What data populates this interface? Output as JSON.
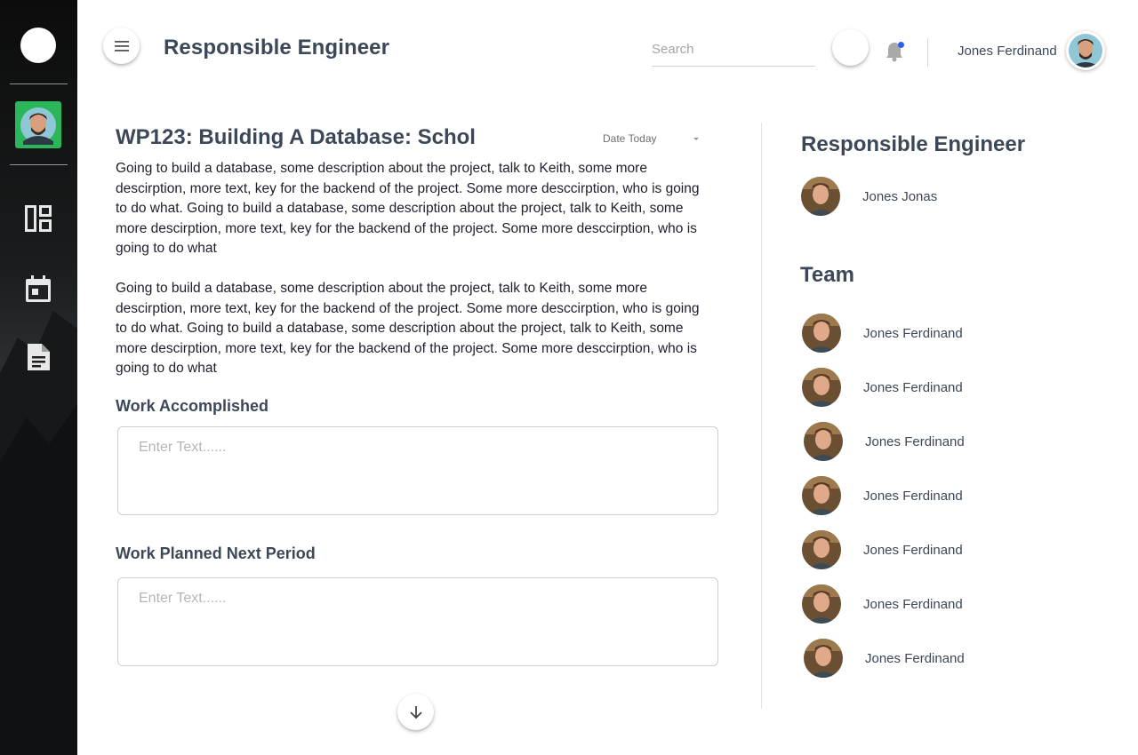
{
  "header": {
    "title": "Responsible Engineer",
    "search_placeholder": "Search",
    "user_name": "Jones Ferdinand"
  },
  "sidebar": {
    "items": [
      {
        "icon": "dashboard-icon"
      },
      {
        "icon": "calendar-icon"
      },
      {
        "icon": "document-icon"
      }
    ]
  },
  "work_package": {
    "title": "WP123: Building A Database: Schol",
    "date_filter": "Date Today",
    "description_1": "Going to build a database, some description about the project, talk to Keith, some more descirption, more text, key for the backend of the project. Some more desccirption, who is going to do what. Going to build a database, some description about the project, talk to Keith, some more descirption, more text, key for the backend of the project. Some more desccirption, who is going to do what",
    "description_2": "Going to build a database, some description about the project, talk to Keith, some more descirption, more text, key for the backend of the project. Some more desccirption, who is going to do what. Going to build a database, some description about the project, talk to Keith, some more descirption, more text, key for the backend of the project. Some more desccirption, who is going to do what"
  },
  "form": {
    "work_accomplished_label": "Work Accomplished",
    "work_accomplished_placeholder": "Enter Text......",
    "work_planned_label": "Work Planned Next Period",
    "work_planned_placeholder": "Enter Text......"
  },
  "responsible": {
    "heading": "Responsible Engineer",
    "name": "Jones Jonas"
  },
  "team": {
    "heading": "Team",
    "members": [
      "Jones Ferdinand",
      "Jones Ferdinand",
      "Jones Ferdinand",
      "Jones Ferdinand",
      "Jones Ferdinand",
      "Jones Ferdinand",
      "Jones Ferdinand"
    ]
  },
  "colors": {
    "accent_green": "#2bb65c",
    "notification_dot": "#2f5cf0",
    "title_text": "#3c4858"
  }
}
